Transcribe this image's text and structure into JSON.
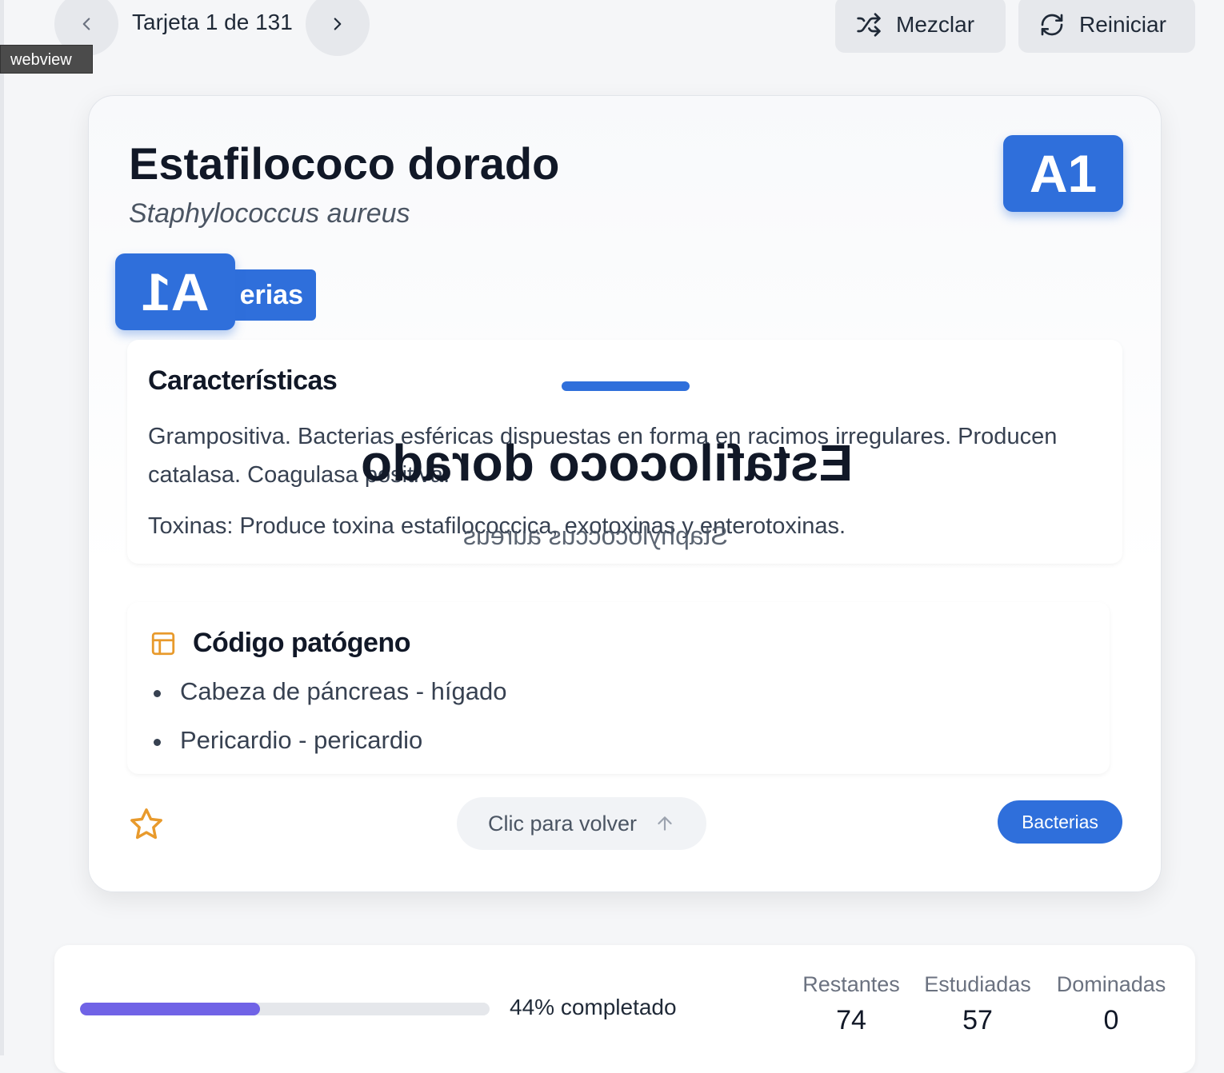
{
  "webview_label": "webview",
  "nav": {
    "counter": "Tarjeta 1 de 131",
    "shuffle_label": "Mezclar",
    "reset_label": "Reiniciar"
  },
  "card": {
    "title": "Estafilococo dorado",
    "subtitle": "Staphylococcus aureus",
    "badge": "A1",
    "mirrored_badge": "A1",
    "category_partial": "erias",
    "characteristics": {
      "heading": "Características",
      "paragraph1": "Grampositiva. Bacterias esféricas dispuestas en forma en racimos irregulares. Producen catalasa. Coagulasa positiva.",
      "paragraph2": "Toxinas: Produce toxina estafilococcica, exotoxinas y enterotoxinas."
    },
    "pathogen_code": {
      "heading": "Código patógeno",
      "items": [
        "Cabeza de páncreas - hígado",
        "Pericardio - pericardio"
      ]
    },
    "flip_hint": "Clic para volver",
    "tag": "Bacterias",
    "mirrored_title": "Estafilococo dorado",
    "mirrored_subtitle": "Staphylococcus aureus"
  },
  "progress": {
    "percent": 44,
    "label": "44% completado"
  },
  "stats": [
    {
      "label": "Restantes",
      "value": "74"
    },
    {
      "label": "Estudiadas",
      "value": "57"
    },
    {
      "label": "Dominadas",
      "value": "0"
    }
  ],
  "colors": {
    "accent": "#2f6fdb",
    "progress": "#7063e6",
    "star": "#e89a2c"
  },
  "icons": [
    "chevron-left-icon",
    "chevron-right-icon",
    "shuffle-icon",
    "refresh-icon",
    "table-icon",
    "star-icon",
    "arrow-up-icon"
  ]
}
